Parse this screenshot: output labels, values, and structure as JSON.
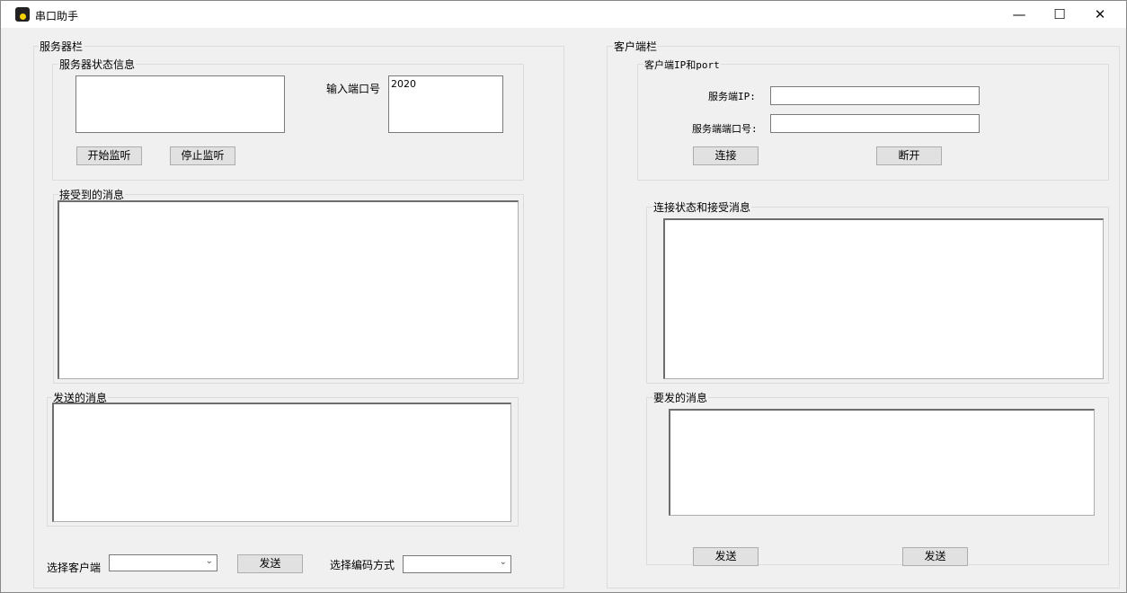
{
  "window": {
    "title": "串口助手",
    "minimize": "—",
    "maximize": "☐",
    "close": "✕"
  },
  "server": {
    "group_label": "服务器栏",
    "status_group_label": "服务器状态信息",
    "status_text": "",
    "port_label": "输入端口号",
    "port_value": "2020",
    "start_button": "开始监听",
    "stop_button": "停止监听",
    "received_label": "接受到的消息",
    "received_text": "",
    "sent_label": "发送的消息",
    "sent_text": "",
    "client_select_label": "选择客户端",
    "client_select_value": "",
    "send_button": "发送",
    "encoding_label": "选择编码方式",
    "encoding_value": ""
  },
  "client": {
    "group_label": "客户端栏",
    "conn_group_label": "客户端IP和port",
    "ip_label": "服务端IP:",
    "ip_value": "",
    "port_label": "服务端端口号:",
    "port_value": "",
    "connect_button": "连接",
    "disconnect_button": "断开",
    "status_label": "连接状态和接受消息",
    "status_text": "",
    "send_label": "要发的消息",
    "send_text": "",
    "send_button_1": "发送",
    "send_button_2": "发送"
  }
}
